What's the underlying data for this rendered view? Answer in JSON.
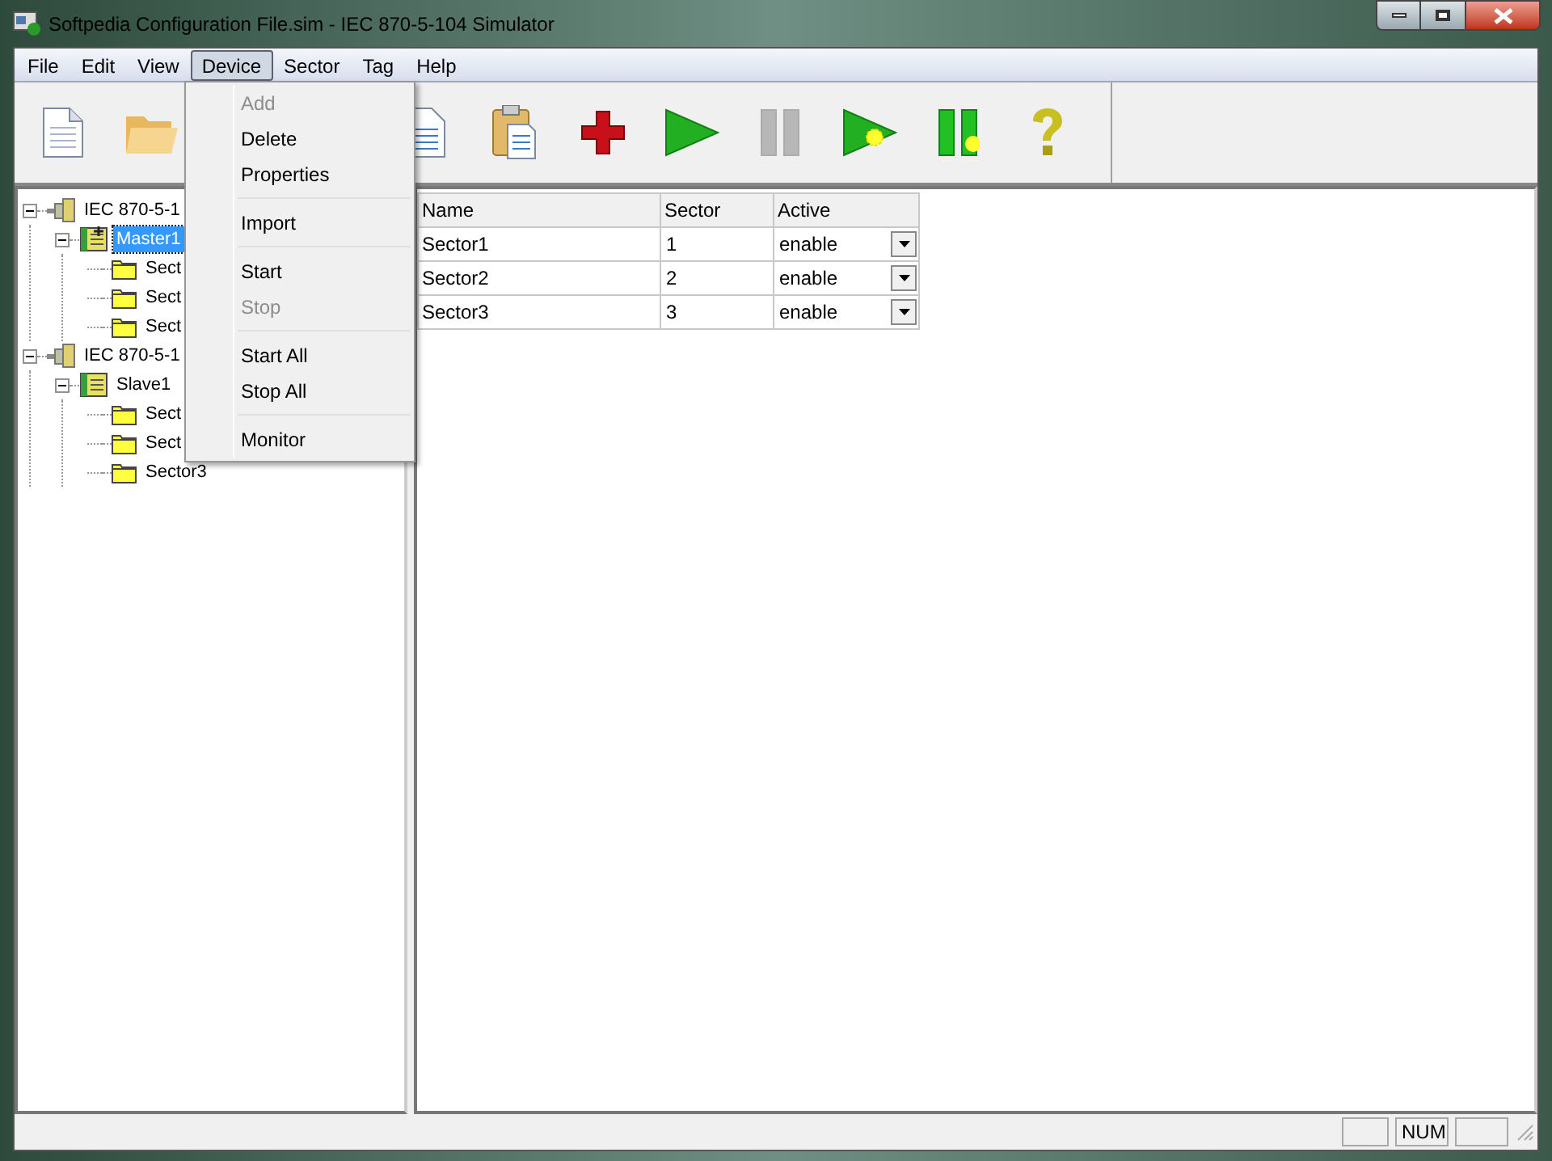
{
  "window": {
    "title": "Softpedia Configuration File.sim - IEC 870-5-104 Simulator"
  },
  "menu_bar": [
    {
      "label": "File",
      "selected": false
    },
    {
      "label": "Edit",
      "selected": false
    },
    {
      "label": "View",
      "selected": false
    },
    {
      "label": "Device",
      "selected": true
    },
    {
      "label": "Sector",
      "selected": false
    },
    {
      "label": "Tag",
      "selected": false
    },
    {
      "label": "Help",
      "selected": false
    }
  ],
  "toolbar": [
    {
      "kind": "new",
      "disabled": false
    },
    {
      "kind": "open",
      "disabled": false
    },
    {
      "kind": "copy",
      "disabled": false
    },
    {
      "kind": "paste",
      "disabled": false
    },
    {
      "kind": "add",
      "disabled": false
    },
    {
      "kind": "start",
      "disabled": false
    },
    {
      "kind": "stop",
      "disabled": true
    },
    {
      "kind": "start_all",
      "disabled": false
    },
    {
      "kind": "stop_all",
      "disabled": false
    },
    {
      "kind": "help",
      "disabled": false
    }
  ],
  "tree": [
    {
      "label": "IEC 870-5-1",
      "kind": "protocol",
      "selected": false,
      "expanded": true,
      "children": [
        {
          "label": "Master1",
          "kind": "master",
          "selected": true,
          "expanded": true,
          "children": [
            {
              "label": "Sect",
              "kind": "sector",
              "selected": false
            },
            {
              "label": "Sect",
              "kind": "sector",
              "selected": false
            },
            {
              "label": "Sect",
              "kind": "sector",
              "selected": false
            }
          ]
        }
      ]
    },
    {
      "label": "IEC 870-5-1",
      "kind": "protocol",
      "selected": false,
      "expanded": true,
      "children": [
        {
          "label": "Slave1",
          "kind": "slave",
          "selected": false,
          "expanded": true,
          "children": [
            {
              "label": "Sect",
              "kind": "sector",
              "selected": false
            },
            {
              "label": "Sect",
              "kind": "sector",
              "selected": false
            },
            {
              "label": "Sector3",
              "kind": "sector",
              "selected": false
            }
          ]
        }
      ]
    }
  ],
  "table": {
    "columns": [
      "Name",
      "Sector",
      "Active"
    ],
    "rows": [
      {
        "name": "Sector1",
        "sector": "1",
        "active": "enable"
      },
      {
        "name": "Sector2",
        "sector": "2",
        "active": "enable"
      },
      {
        "name": "Sector3",
        "sector": "3",
        "active": "enable"
      }
    ]
  },
  "device_menu": [
    {
      "kind": "item",
      "label": "Add",
      "disabled": true
    },
    {
      "kind": "item",
      "label": "Delete",
      "disabled": false
    },
    {
      "kind": "item",
      "label": "Properties",
      "disabled": false
    },
    {
      "kind": "separator"
    },
    {
      "kind": "item",
      "label": "Import",
      "disabled": false
    },
    {
      "kind": "separator"
    },
    {
      "kind": "item",
      "label": "Start",
      "disabled": false
    },
    {
      "kind": "item",
      "label": "Stop",
      "disabled": true
    },
    {
      "kind": "separator"
    },
    {
      "kind": "item",
      "label": "Start All",
      "disabled": false
    },
    {
      "kind": "item",
      "label": "Stop All",
      "disabled": false
    },
    {
      "kind": "separator"
    },
    {
      "kind": "item",
      "label": "Monitor",
      "disabled": false
    }
  ],
  "status_bar": {
    "indicator": "NUM"
  }
}
